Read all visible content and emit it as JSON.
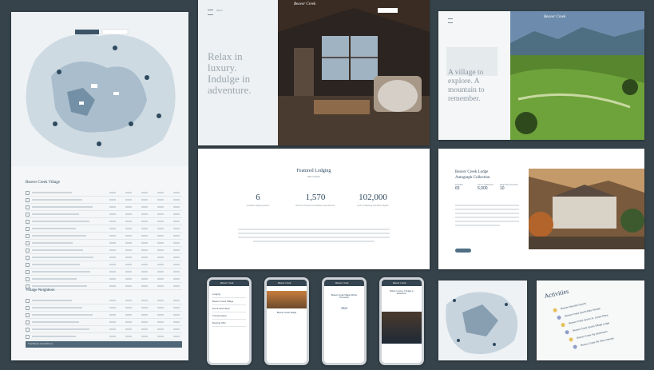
{
  "hero": {
    "logo": "Beaver Creek",
    "headline_lines": [
      "Relax in",
      "luxury.",
      "Indulge in",
      "adventure."
    ],
    "menu_label": "MENU"
  },
  "featured": {
    "title": "Featured Lodging",
    "subtitle": "BEST RATES",
    "stats": [
      {
        "value": "6",
        "label": "Curated Lodging Options"
      },
      {
        "value": "1,570",
        "label": "Rooms and Accommodation Guest Rooms"
      },
      {
        "value": "102,000",
        "label": "Sq Ft of Meeting and Event Space"
      }
    ]
  },
  "village": {
    "logo": "Beaver Creek",
    "headline_lines": [
      "A village to",
      "explore. A",
      "mountain to",
      "remember."
    ]
  },
  "lodge": {
    "title_lines": [
      "Beaver Creek Lodge",
      "Autograph Collection"
    ],
    "stats": [
      {
        "value": "65",
        "label": "ROOMS"
      },
      {
        "value": "6,000",
        "label": "SQ FT MEETING"
      },
      {
        "value": "10",
        "label": "MEETING ROOMS"
      }
    ]
  },
  "table": {
    "title1": "Beaver Creek Village",
    "title2": "Village Neighbors",
    "footer_label": "Total Beaver Creek Rooms"
  },
  "phones": [
    {
      "logo": "Beaver Creek",
      "items": [
        "Lodging",
        "Beaver Creek Village",
        "Event Information",
        "Transportation",
        "Meeting Offer"
      ]
    },
    {
      "logo": "Beaver Creek",
      "caption": "Beaver Creek Village"
    },
    {
      "logo": "Beaver Creek",
      "caption": "Beaver Creek Village Winter Promotion",
      "year": "2022"
    },
    {
      "logo": "Beaver Creek",
      "caption": "Relax in luxury. Indulge in adventure."
    }
  ],
  "activities": {
    "title": "Activities",
    "items": [
      "Beaver Mountain Sports",
      "Beaver Creek Sports Bike Rentals",
      "Beaver Creek Sports St. James Place",
      "Beaver Creek Sports Village Lodge",
      "Beaver Creek Fly Adventures",
      "Beaver Creek Ski Shop Rentals"
    ]
  },
  "colors": {
    "background": "#36434b",
    "navy": "#2f4a5e",
    "accent": "#4f6f86"
  }
}
